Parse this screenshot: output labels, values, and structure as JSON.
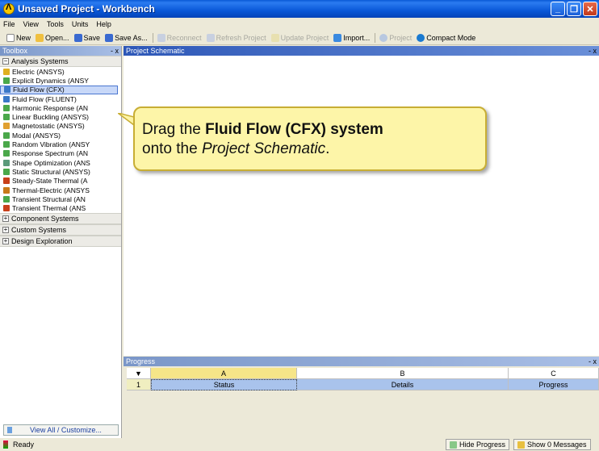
{
  "window": {
    "title": "Unsaved Project - Workbench"
  },
  "menu": [
    "File",
    "View",
    "Tools",
    "Units",
    "Help"
  ],
  "toolbar": {
    "new": "New",
    "open": "Open...",
    "save": "Save",
    "save_as": "Save As...",
    "reconnect": "Reconnect",
    "refresh_project": "Refresh Project",
    "update_project": "Update Project",
    "import": "Import...",
    "project": "Project",
    "compact_mode": "Compact Mode"
  },
  "toolbox": {
    "title": "Toolbox",
    "controls": "- x",
    "groups": {
      "analysis": "Analysis Systems",
      "component": "Component Systems",
      "custom": "Custom Systems",
      "design": "Design Exploration"
    },
    "items": [
      {
        "label": "Electric (ANSYS)",
        "color": "#e0b020"
      },
      {
        "label": "Explicit Dynamics (ANSY",
        "color": "#4aa84a"
      },
      {
        "label": "Fluid Flow (CFX)",
        "color": "#3a78c8"
      },
      {
        "label": "Fluid Flow (FLUENT)",
        "color": "#3a78c8"
      },
      {
        "label": "Harmonic Response (AN",
        "color": "#4aa84a"
      },
      {
        "label": "Linear Buckling (ANSYS)",
        "color": "#4aa84a"
      },
      {
        "label": "Magnetostatic (ANSYS)",
        "color": "#e0a030"
      },
      {
        "label": "Modal (ANSYS)",
        "color": "#4aa84a"
      },
      {
        "label": "Random Vibration (ANSY",
        "color": "#4aa84a"
      },
      {
        "label": "Response Spectrum (AN",
        "color": "#4aa84a"
      },
      {
        "label": "Shape Optimization (ANS",
        "color": "#5a9a7a"
      },
      {
        "label": "Static Structural (ANSYS)",
        "color": "#4aa84a"
      },
      {
        "label": "Steady-State Thermal (A",
        "color": "#c8401a"
      },
      {
        "label": "Thermal-Electric (ANSYS",
        "color": "#c87a1a"
      },
      {
        "label": "Transient Structural (AN",
        "color": "#4aa84a"
      },
      {
        "label": "Transient Thermal (ANS",
        "color": "#c8401a"
      }
    ],
    "footer": "View All / Customize..."
  },
  "schematic": {
    "title": "Project Schematic",
    "controls": "- x",
    "callout": {
      "prefix": "Drag the ",
      "bold": "Fluid Flow (CFX) system",
      "middle": "onto the ",
      "italic": "Project Schematic",
      "suffix": "."
    }
  },
  "progress": {
    "title": "Progress",
    "controls": "- x",
    "columns": [
      "",
      "A",
      "B",
      "C"
    ],
    "col_arrow": "▼",
    "row": {
      "index": "1",
      "status": "Status",
      "details": "Details",
      "progress": "Progress"
    }
  },
  "statusbar": {
    "status": "Ready",
    "hide_progress": "Hide Progress",
    "show_messages": "Show 0 Messages"
  }
}
